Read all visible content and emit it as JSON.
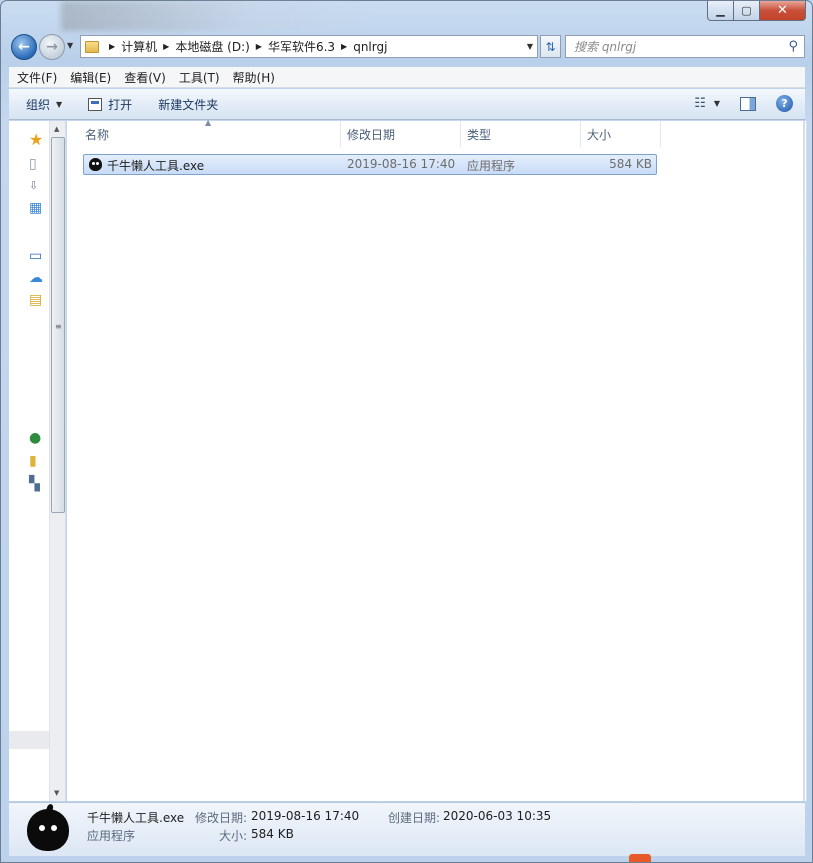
{
  "window": {
    "caption": {
      "minimize": "▁",
      "maximize": "▢",
      "close": "✕"
    }
  },
  "nav": {
    "back_icon": "back-arrow-icon",
    "forward_icon": "forward-arrow-icon",
    "breadcrumb": [
      "计算机",
      "本地磁盘 (D:)",
      "华军软件6.3",
      "qnlrgj"
    ],
    "search_placeholder": "搜索 qnlrgj"
  },
  "menu": [
    "文件(F)",
    "编辑(E)",
    "查看(V)",
    "工具(T)",
    "帮助(H)"
  ],
  "toolbar": {
    "organize": "组织",
    "open": "打开",
    "new_folder": "新建文件夹"
  },
  "columns": [
    "名称",
    "修改日期",
    "类型",
    "大小"
  ],
  "files": [
    {
      "name": "千牛懒人工具.exe",
      "modified": "2019-08-16 17:40",
      "type": "应用程序",
      "size": "584 KB"
    }
  ],
  "details": {
    "name": "千牛懒人工具.exe",
    "modified_label": "修改日期:",
    "modified": "2019-08-16 17:40",
    "created_label": "创建日期:",
    "created": "2020-06-03 10:35",
    "type": "应用程序",
    "size_label": "大小:",
    "size": "584 KB"
  }
}
